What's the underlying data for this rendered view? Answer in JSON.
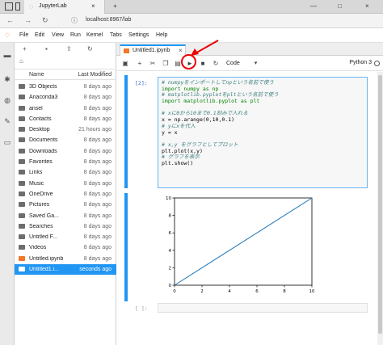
{
  "browser": {
    "tab_title": "JupyterLab",
    "url": "localhost:8967/lab",
    "tab_close": "×",
    "window_controls": [
      "—",
      "□",
      "×"
    ]
  },
  "menu": {
    "items": [
      "File",
      "Edit",
      "View",
      "Run",
      "Kernel",
      "Tabs",
      "Settings",
      "Help"
    ]
  },
  "filebrowser": {
    "headers": {
      "name": "Name",
      "modified": "Last Modified"
    },
    "files": [
      {
        "name": "3D Objects",
        "modified": "8 days ago",
        "type": "folder"
      },
      {
        "name": "Anaconda3",
        "modified": "8 days ago",
        "type": "folder"
      },
      {
        "name": "ansel",
        "modified": "8 days ago",
        "type": "folder"
      },
      {
        "name": "Contacts",
        "modified": "8 days ago",
        "type": "folder"
      },
      {
        "name": "Desktop",
        "modified": "21 hours ago",
        "type": "folder"
      },
      {
        "name": "Documents",
        "modified": "8 days ago",
        "type": "folder"
      },
      {
        "name": "Downloads",
        "modified": "8 days ago",
        "type": "folder"
      },
      {
        "name": "Favorites",
        "modified": "8 days ago",
        "type": "folder"
      },
      {
        "name": "Links",
        "modified": "8 days ago",
        "type": "folder"
      },
      {
        "name": "Music",
        "modified": "8 days ago",
        "type": "folder"
      },
      {
        "name": "OneDrive",
        "modified": "8 days ago",
        "type": "folder"
      },
      {
        "name": "Pictures",
        "modified": "8 days ago",
        "type": "folder"
      },
      {
        "name": "Saved Ga...",
        "modified": "8 days ago",
        "type": "folder"
      },
      {
        "name": "Searches",
        "modified": "8 days ago",
        "type": "folder"
      },
      {
        "name": "Untitled F...",
        "modified": "8 days ago",
        "type": "folder"
      },
      {
        "name": "Videos",
        "modified": "8 days ago",
        "type": "folder"
      },
      {
        "name": "Untitled.ipynb",
        "modified": "8 days ago",
        "type": "notebook"
      },
      {
        "name": "Untitled1.i...",
        "modified": "seconds ago",
        "type": "notebook-selected"
      }
    ]
  },
  "notebook": {
    "tab_title": "Untitled1.ipynb",
    "tab_close": "×",
    "cell_type": "Code",
    "kernel": "Python 3",
    "cell1_prompt": "[2]:",
    "cell2_prompt": "[ ]:",
    "code_lines": [
      {
        "text": "# numpyをインポートしてnpという名前で使う",
        "style": "comment"
      },
      {
        "text": "import numpy as np",
        "style": "kw"
      },
      {
        "text": "# matplotlib.pyplotをpltという名前で使う",
        "style": "comment"
      },
      {
        "text": "import matplotlib.pyplot as plt",
        "style": "kw"
      },
      {
        "text": "",
        "style": ""
      },
      {
        "text": "# xに0から10まで0.1刻みで入れる",
        "style": "comment"
      },
      {
        "text": "x = np.arange(0,10,0.1)",
        "style": ""
      },
      {
        "text": "# yにxを代入",
        "style": "comment"
      },
      {
        "text": "y = x",
        "style": ""
      },
      {
        "text": "",
        "style": ""
      },
      {
        "text": "# x,y をグラフとしてプロット",
        "style": "comment"
      },
      {
        "text": "plt.plot(x,y)",
        "style": ""
      },
      {
        "text": "# グラフを表示",
        "style": "comment"
      },
      {
        "text": "plt.show()",
        "style": ""
      }
    ]
  },
  "chart_data": {
    "type": "line",
    "x": [
      0,
      10
    ],
    "y": [
      0,
      10
    ],
    "xlim": [
      0,
      10
    ],
    "ylim": [
      0,
      10
    ],
    "xticks": [
      "0",
      "2",
      "4",
      "6",
      "8",
      "10"
    ],
    "yticks": [
      "0",
      "2",
      "4",
      "6",
      "8",
      "10"
    ],
    "line_color": "#1f77b4",
    "title": "",
    "xlabel": "",
    "ylabel": ""
  }
}
